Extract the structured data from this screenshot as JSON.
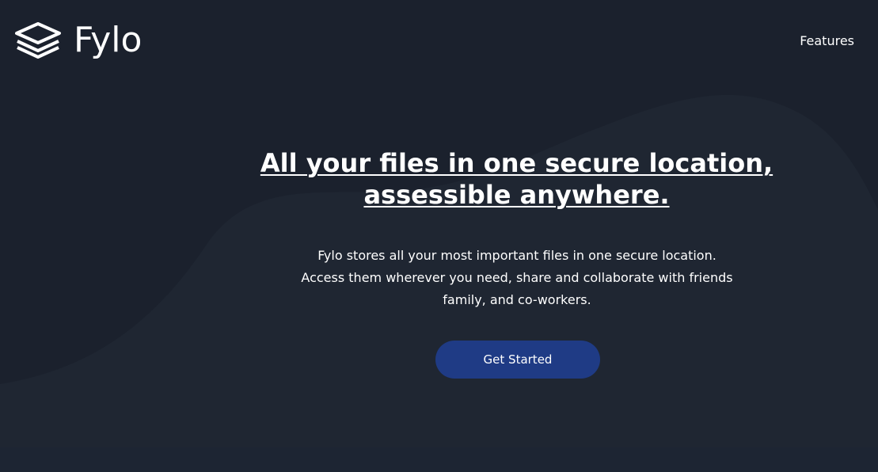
{
  "brand": {
    "name": "Fylo",
    "logo_icon": "stacked-layers-icon"
  },
  "nav": {
    "features_label": "Features"
  },
  "hero": {
    "headline_line1": "All your files in one secure location,",
    "headline_line2": "assessible anywhere.",
    "description_line1": "Fylo stores all your most important files in one secure location.",
    "description_line2": "Access them wherever you need, share and collaborate with friends",
    "description_line3": "family, and co-workers.",
    "cta_label": "Get Started"
  },
  "colors": {
    "background": "#1b212d",
    "curve": "#1f2531",
    "button": "#1f3b85",
    "text": "#ffffff"
  }
}
